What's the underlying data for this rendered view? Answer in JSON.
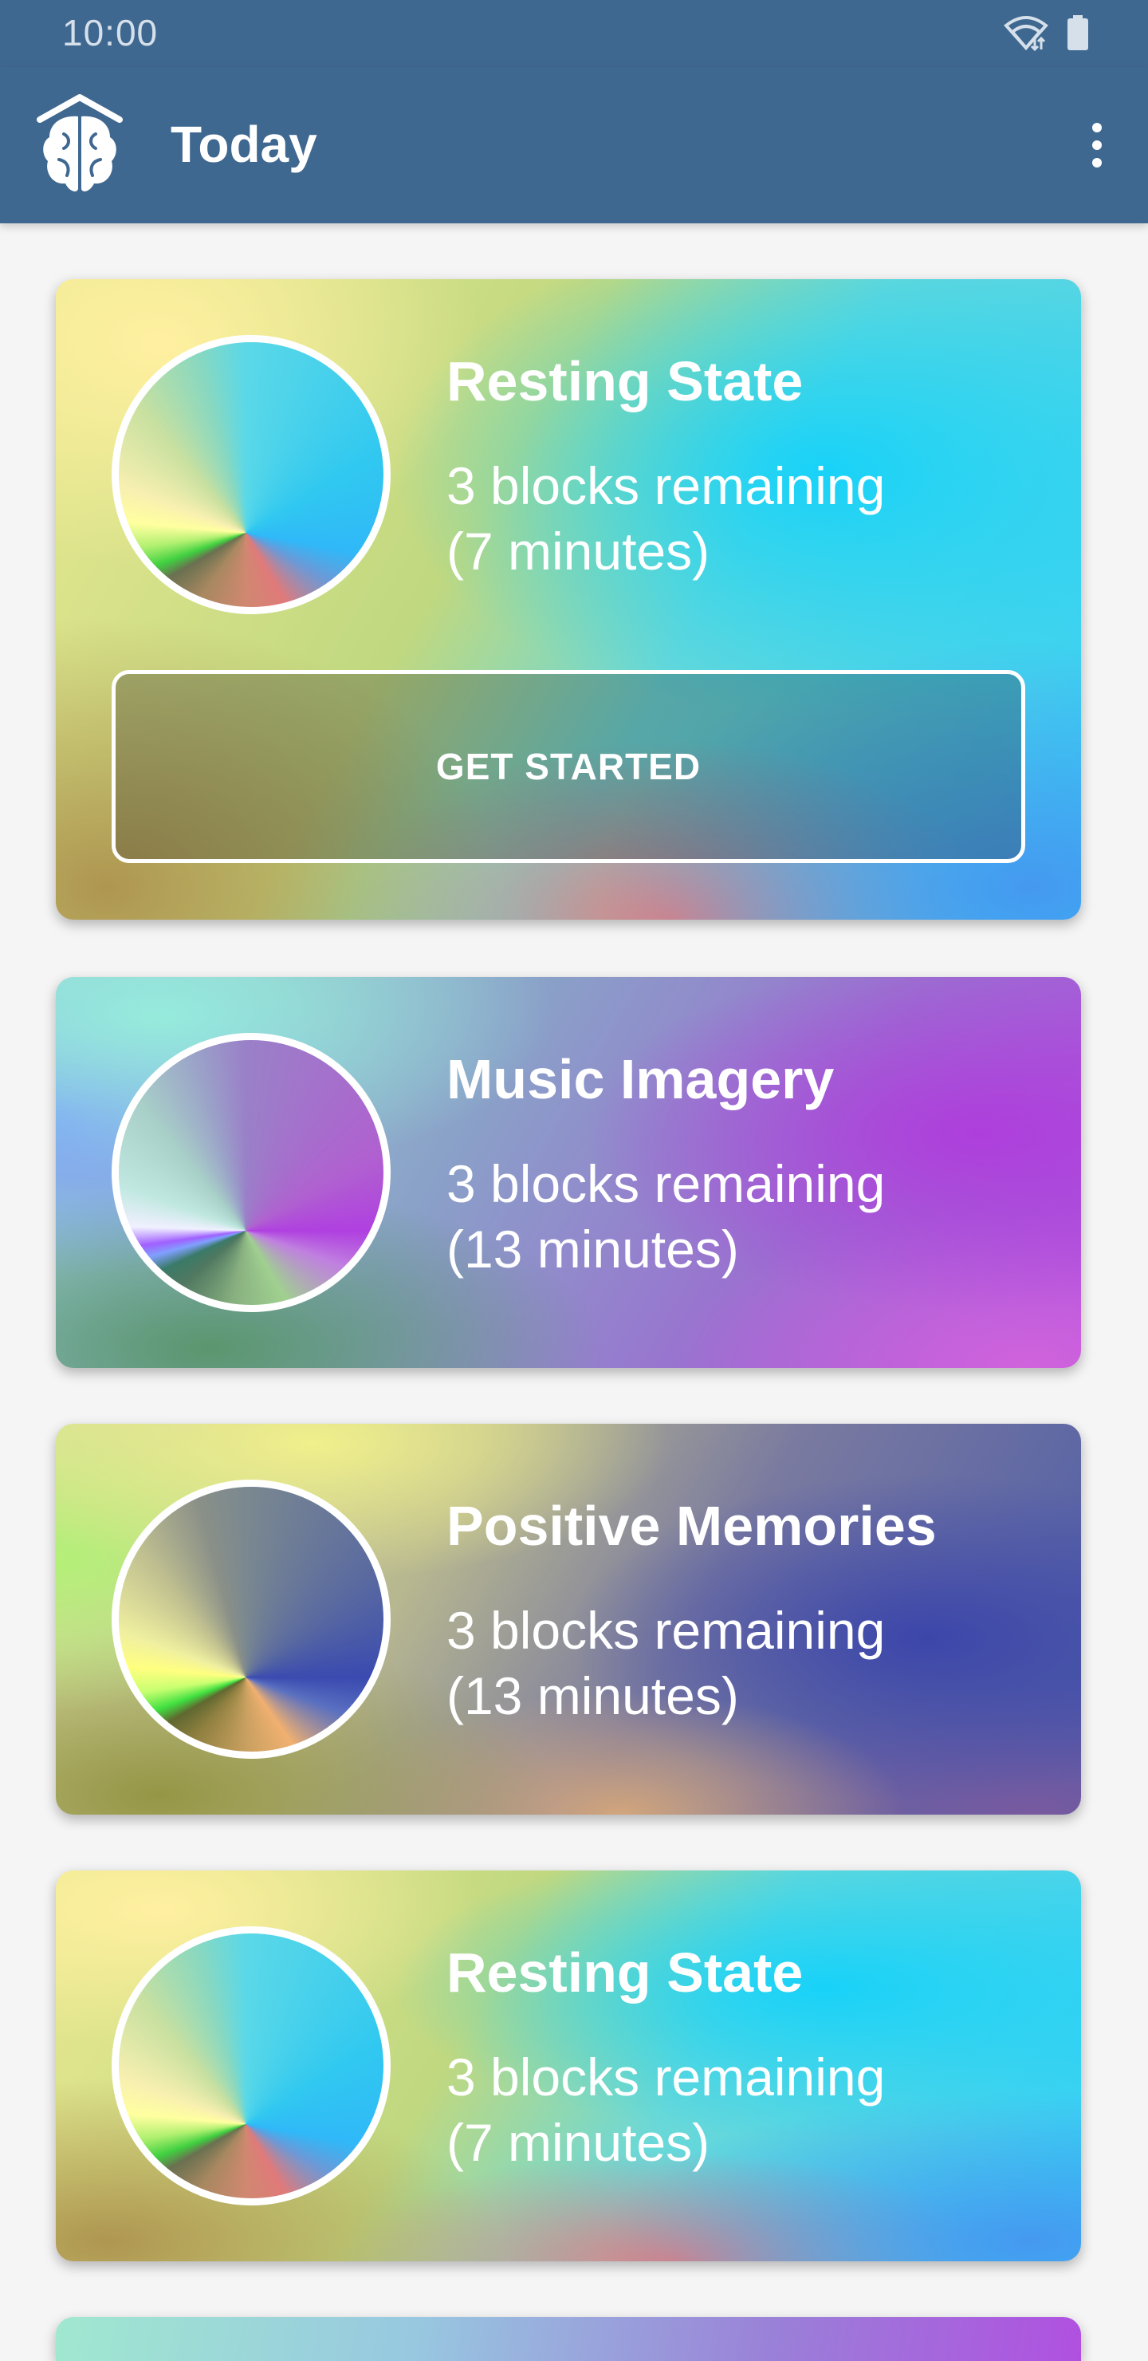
{
  "status_bar": {
    "time": "10:00",
    "icons": [
      "wifi-icon",
      "battery-icon"
    ]
  },
  "app_bar": {
    "title": "Today",
    "logo": "brain-logo-icon",
    "menu_icon": "more-vert-icon"
  },
  "cards": [
    {
      "title": "Resting State",
      "line1": "3 blocks remaining",
      "line2": "(7 minutes)",
      "button_label": "GET STARTED"
    },
    {
      "title": "Music Imagery",
      "line1": "3 blocks remaining",
      "line2": "(13 minutes)"
    },
    {
      "title": "Positive Memories",
      "line1": "3 blocks remaining",
      "line2": "(13 minutes)"
    },
    {
      "title": "Resting State",
      "line1": "3 blocks remaining",
      "line2": "(7 minutes)"
    }
  ],
  "colors": {
    "app_bar": "#3f6891",
    "background": "#f5f5f5"
  }
}
